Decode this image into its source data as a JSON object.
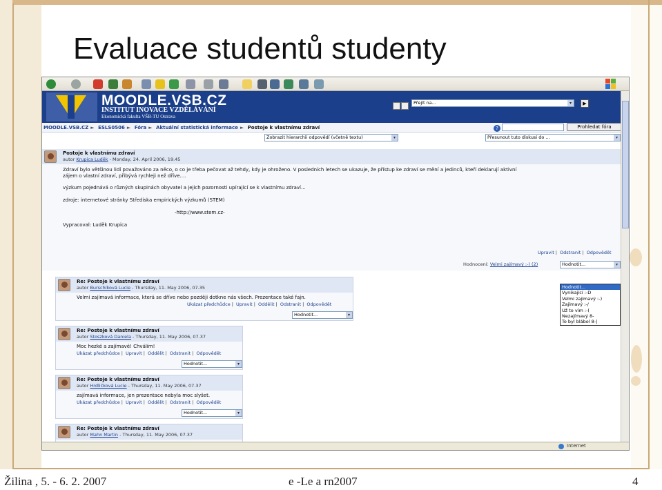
{
  "slide": {
    "title": "Evaluace studentů studenty",
    "footer_left": "Žilina , 5. - 6. 2. 2007",
    "footer_center": "e -Le a rn2007",
    "page_number": "4"
  },
  "moodle": {
    "brand": "MOODLE.VSB.CZ",
    "institute": "INSTITUT INOVACE VZDĚLÁVÁNÍ",
    "faculty": "Ekonomická fakulta VŠB-TU Ostrava",
    "jump_placeholder": "Přejít na...",
    "breadcrumb": [
      "MOODLE.VSB.CZ",
      "ESLS0506",
      "Fóra",
      "Aktuální statistická informace",
      "Postoje k vlastnímu zdraví"
    ],
    "search_button": "Prohledat fóra",
    "display_mode": "Zobrazit hierarchii odpovědí (včetně textu)",
    "move_discussion": "Přesunout tuto diskusi do ...",
    "status_zone": "Internet"
  },
  "main_post": {
    "title": "Postoje k vlastnímu zdraví",
    "author_prefix": "autor",
    "author": "Krupica Luděk",
    "date": " - Monday, 24. April 2006, 19.45",
    "lines": [
      "Zdraví bylo většinou lidí považováno za něco, o co je třeba pečovat až tehdy, kdy je ohroženo. V posledních letech se ukazuje, že přístup ke zdraví se mění a jedinců, kteří deklarují aktivní",
      "zájem o vlastní zdraví, přibývá rychleji než dříve....",
      "výzkum pojednává o různých skupinách obyvatel a jejich pozornosti upírající se k vlastnímu zdraví...",
      "zdroje:   internetové stránky Střediska empirických výzkumů (STEM)",
      "-http://www.stem.cz-",
      "Vypracoval: Luděk Krupica"
    ],
    "links": [
      "Upravit",
      "Odstranit",
      "Odpovědět"
    ],
    "rating_label": "Hodnocení:",
    "rating_value": "Velmi zajímavý :-) (2)",
    "rating_select": "Hodnotit..."
  },
  "rating_options": [
    "Hodnotit...",
    "Vynikající :-D",
    "Velmi zajímavý :-)",
    "Zajímavý :-/",
    "Už to vím :-(",
    "Nezajímavý 8-",
    "To byl blábol 8-|"
  ],
  "replies": [
    {
      "title": "Re: Postoje k vlastnímu zdraví",
      "author": "Burschíková Lucie",
      "date": " - Thursday, 11. May 2006, 07.35",
      "text": "Velmi zajímavá informace, která se dříve nebo později dotkne nás všech. Prezentace také fajn.",
      "links": [
        "Ukázat předchůdce",
        "Upravit",
        "Oddělit",
        "Odstranit",
        "Odpovědět"
      ],
      "select": "Hodnotit..."
    },
    {
      "title": "Re: Postoje k vlastnímu zdraví",
      "author": "Stoszková Daniela",
      "date": " - Thursday, 11. May 2006, 07.37",
      "text": "Moc hezké a zajímavé! Chválím!",
      "links": [
        "Ukázat předchůdce",
        "Upravit",
        "Oddělit",
        "Odstranit",
        "Odpovědět"
      ],
      "select": "Hodnotit..."
    },
    {
      "title": "Re: Postoje k vlastnímu zdraví",
      "author": "Hrdličková Lucie",
      "date": " - Thursday, 11. May 2006, 07.37",
      "text": "zajímavá informace, jen prezentace nebyla moc slyšet.",
      "links": [
        "Ukázat předchůdce",
        "Upravit",
        "Oddělit",
        "Odstranit",
        "Odpovědět"
      ],
      "select": "Hodnotit..."
    },
    {
      "title": "Re: Postoje k vlastnímu zdraví",
      "author": "Mahn Martin",
      "date": " - Thursday, 11. May 2006, 07.37",
      "text": "",
      "links": [],
      "select": ""
    }
  ],
  "author_prefix": "autor",
  "colors": {
    "moodle_blue": "#1b3f8b",
    "link": "#1b3f8b",
    "slide_border": "#c9a877"
  }
}
